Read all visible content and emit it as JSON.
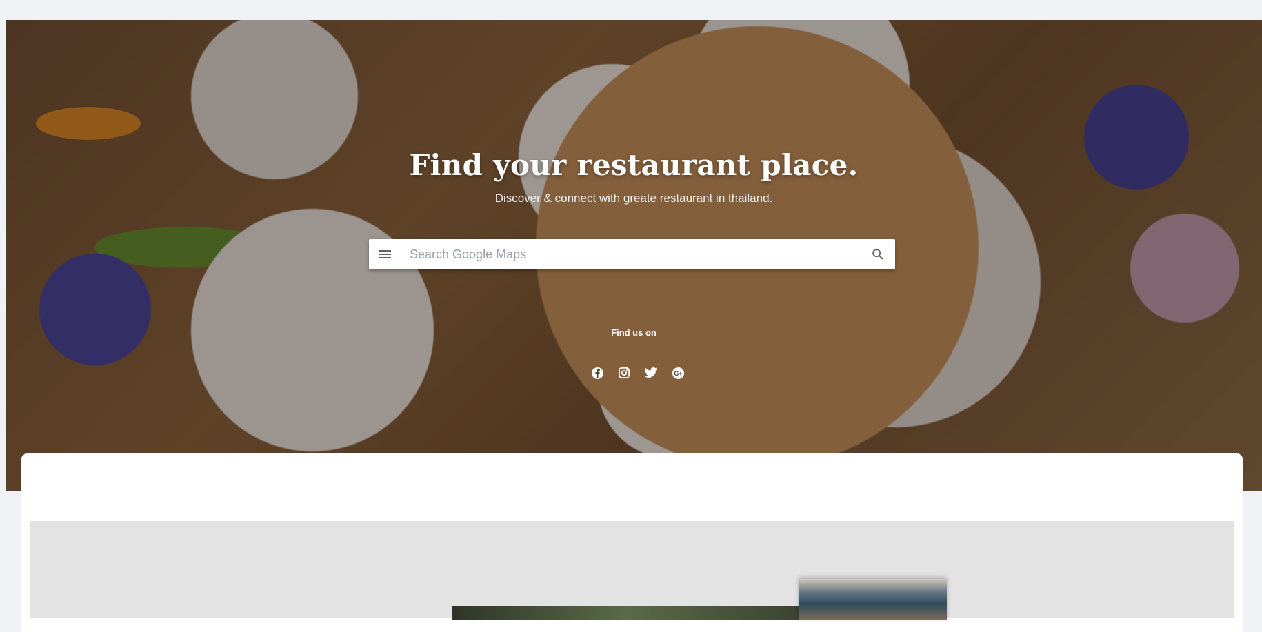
{
  "hero": {
    "title": "Find your restaurant place.",
    "subtitle": "Discover & connect with greate restaurant in thailand."
  },
  "search": {
    "placeholder": "Search Google Maps",
    "value": "",
    "menu_icon": "hamburger-menu-icon",
    "search_icon": "magnifier-icon"
  },
  "social": {
    "label": "Find us on",
    "icons": [
      "facebook-icon",
      "instagram-icon",
      "twitter-icon",
      "google-plus-icon"
    ]
  },
  "colors": {
    "page_bg": "#f0f1f5",
    "gallery_bg": "#e3e3e3",
    "text_on_hero": "#ffffff"
  }
}
